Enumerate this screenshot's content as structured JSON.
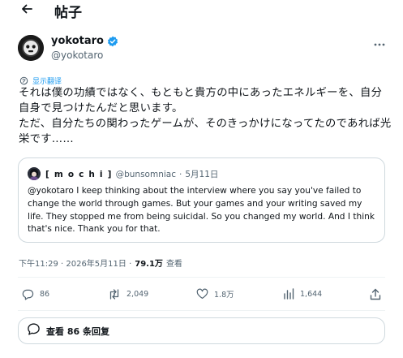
{
  "header": {
    "title": "帖子"
  },
  "author": {
    "display_name": "yokotaro",
    "handle": "@yokotaro"
  },
  "translate": {
    "label": "显示翻译"
  },
  "tweet": {
    "text": "それは僕の功績ではなく、もともと貴方の中にあったエネルギーを、自分自身で見つけたんだと思います。\nただ、自分たちの関わったゲームが、そのきっかけになってたのであれば光栄です……"
  },
  "quote": {
    "display_name": "[ m o c h i ]",
    "handle": "@bunsomniac",
    "separator": "·",
    "date": "5月11日",
    "text": "@yokotaro  I keep thinking about the interview where you say you've failed to change the world through games.  But your games and your writing saved my life.  They stopped me from being suicidal.  So you changed my world.  And I think that's nice.  Thank you for that."
  },
  "meta": {
    "time_date": "下午11:29 · 2026年5月11日 ·",
    "views_count": "79.1万",
    "views_label": "查看"
  },
  "actions": {
    "replies": "86",
    "reposts": "2,049",
    "likes": "1.8万",
    "analytics": "1,644"
  },
  "replies_button": {
    "label": "查看 86 条回复"
  },
  "colors": {
    "accent": "#1d9bf0",
    "text_primary": "#0f1419",
    "text_secondary": "#536471",
    "border": "#cfd9de"
  }
}
